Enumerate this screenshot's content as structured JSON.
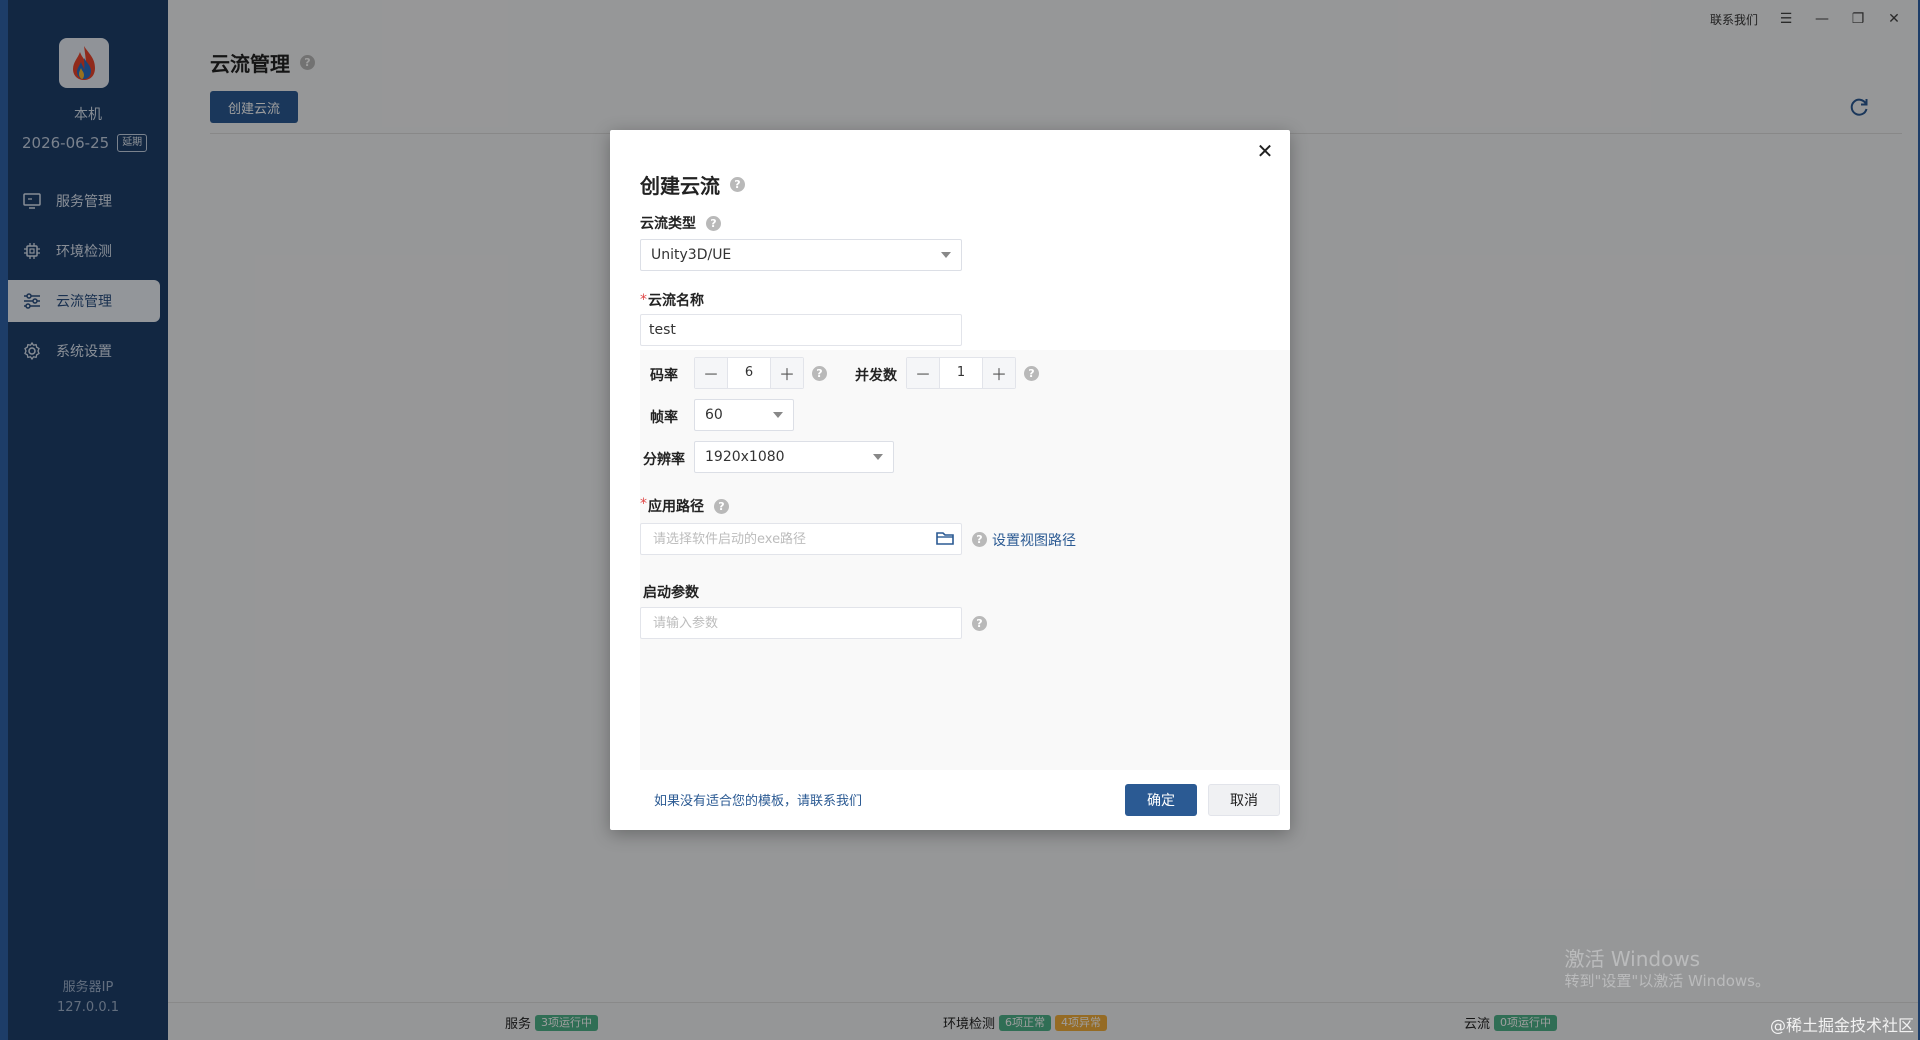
{
  "sidebar": {
    "host_name": "本机",
    "date": "2026-06-25",
    "renew_label": "延期",
    "items": [
      {
        "label": "服务管理",
        "icon": "monitor-icon"
      },
      {
        "label": "环境检测",
        "icon": "chip-icon"
      },
      {
        "label": "云流管理",
        "icon": "sliders-icon",
        "active": true
      },
      {
        "label": "系统设置",
        "icon": "gear-icon"
      }
    ],
    "server_ip_label": "服务器IP",
    "server_ip": "127.0.0.1"
  },
  "topbar": {
    "contact": "联系我们",
    "menu_icon": "menu-icon",
    "minimize_icon": "minimize-icon",
    "restore_icon": "restore-icon",
    "close_icon": "close-icon"
  },
  "page": {
    "title": "云流管理",
    "create_button": "创建云流"
  },
  "statusbar": {
    "service_label": "服务",
    "service_badge": "3项运行中",
    "env_label": "环境检测",
    "env_ok_badge": "6项正常",
    "env_err_badge": "4项异常",
    "stream_label": "云流",
    "stream_badge": "0项运行中"
  },
  "watermark": "@稀土掘金技术社区",
  "windows_activation": {
    "title": "激活 Windows",
    "subtitle": "转到\"设置\"以激活 Windows。"
  },
  "modal": {
    "title": "创建云流",
    "stream_type_label": "云流类型",
    "stream_type_value": "Unity3D/UE",
    "stream_name_label": "云流名称",
    "stream_name_value": "test",
    "bitrate_label": "码率",
    "bitrate_value": "6",
    "concurrency_label": "并发数",
    "concurrency_value": "1",
    "framerate_label": "帧率",
    "framerate_value": "60",
    "resolution_label": "分辨率",
    "resolution_value": "1920x1080",
    "app_path_label": "应用路径",
    "app_path_placeholder": "请选择软件启动的exe路径",
    "set_view_path_link": "设置视图路径",
    "launch_params_label": "启动参数",
    "launch_params_placeholder": "请输入参数",
    "footer_link": "如果没有适合您的模板，请联系我们",
    "confirm_button": "确定",
    "cancel_button": "取消",
    "required_mark": "*",
    "minus": "－",
    "plus": "＋",
    "help_mark": "?"
  },
  "colors": {
    "sidebar_bg": "#1e3f6b",
    "primary": "#2b5a93",
    "badge_green": "#4eb28a",
    "badge_orange": "#f0ad3a"
  }
}
